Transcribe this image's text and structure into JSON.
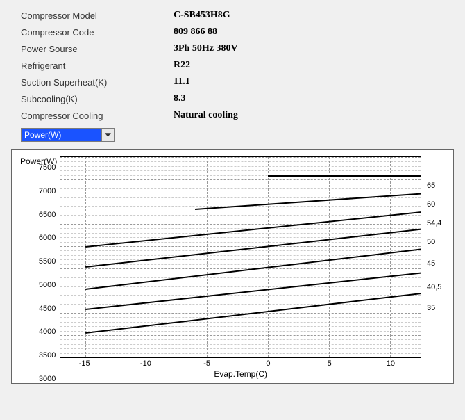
{
  "specs": [
    {
      "label": "Compressor Model",
      "value": "C-SB453H8G"
    },
    {
      "label": "Compressor Code",
      "value": "809 866 88"
    },
    {
      "label": "Power Sourse",
      "value": "3Ph  50Hz  380V"
    },
    {
      "label": "Refrigerant",
      "value": "R22"
    },
    {
      "label": "Suction Superheat(K)",
      "value": "11.1"
    },
    {
      "label": "Subcooling(K)",
      "value": "8.3"
    },
    {
      "label": "Compressor Cooling",
      "value": "Natural cooling"
    }
  ],
  "dropdown": {
    "value": "Power(W)"
  },
  "chart_data": {
    "type": "line",
    "title": "",
    "y_label": "Power(W)",
    "x_label": "Evap.Temp(C)",
    "y_ticks": [
      7500,
      7000,
      6500,
      6000,
      5500,
      5000,
      4500,
      4000,
      3500,
      3000
    ],
    "x_ticks": [
      -15,
      -10,
      -5,
      0,
      5,
      10
    ],
    "ylim": [
      3000,
      7500
    ],
    "xlim": [
      -17,
      12.5
    ],
    "legend_labels": [
      "65",
      "60",
      "54,4",
      "50",
      "45",
      "40,5",
      "35"
    ],
    "legend_label_y": [
      7100,
      6700,
      6300,
      5900,
      5450,
      4950,
      4500
    ],
    "series": [
      {
        "name": "65",
        "segments": [
          {
            "x0": 0,
            "x1": 12.5,
            "y0": 7100,
            "y1": 7100
          }
        ]
      },
      {
        "name": "60",
        "segments": [
          {
            "x0": -6,
            "x1": 12.5,
            "y0": 6350,
            "y1": 6700
          }
        ]
      },
      {
        "name": "54,4",
        "segments": [
          {
            "x0": -15,
            "x1": 12.5,
            "y0": 5500,
            "y1": 6280
          }
        ]
      },
      {
        "name": "50",
        "segments": [
          {
            "x0": -15,
            "x1": 12.5,
            "y0": 5050,
            "y1": 5900
          }
        ]
      },
      {
        "name": "45",
        "segments": [
          {
            "x0": -15,
            "x1": 12.5,
            "y0": 4550,
            "y1": 5450
          }
        ]
      },
      {
        "name": "40,5",
        "segments": [
          {
            "x0": -15,
            "x1": 12.5,
            "y0": 4100,
            "y1": 4920
          }
        ]
      },
      {
        "name": "35",
        "segments": [
          {
            "x0": -15,
            "x1": 12.5,
            "y0": 3560,
            "y1": 4450
          }
        ]
      }
    ]
  }
}
